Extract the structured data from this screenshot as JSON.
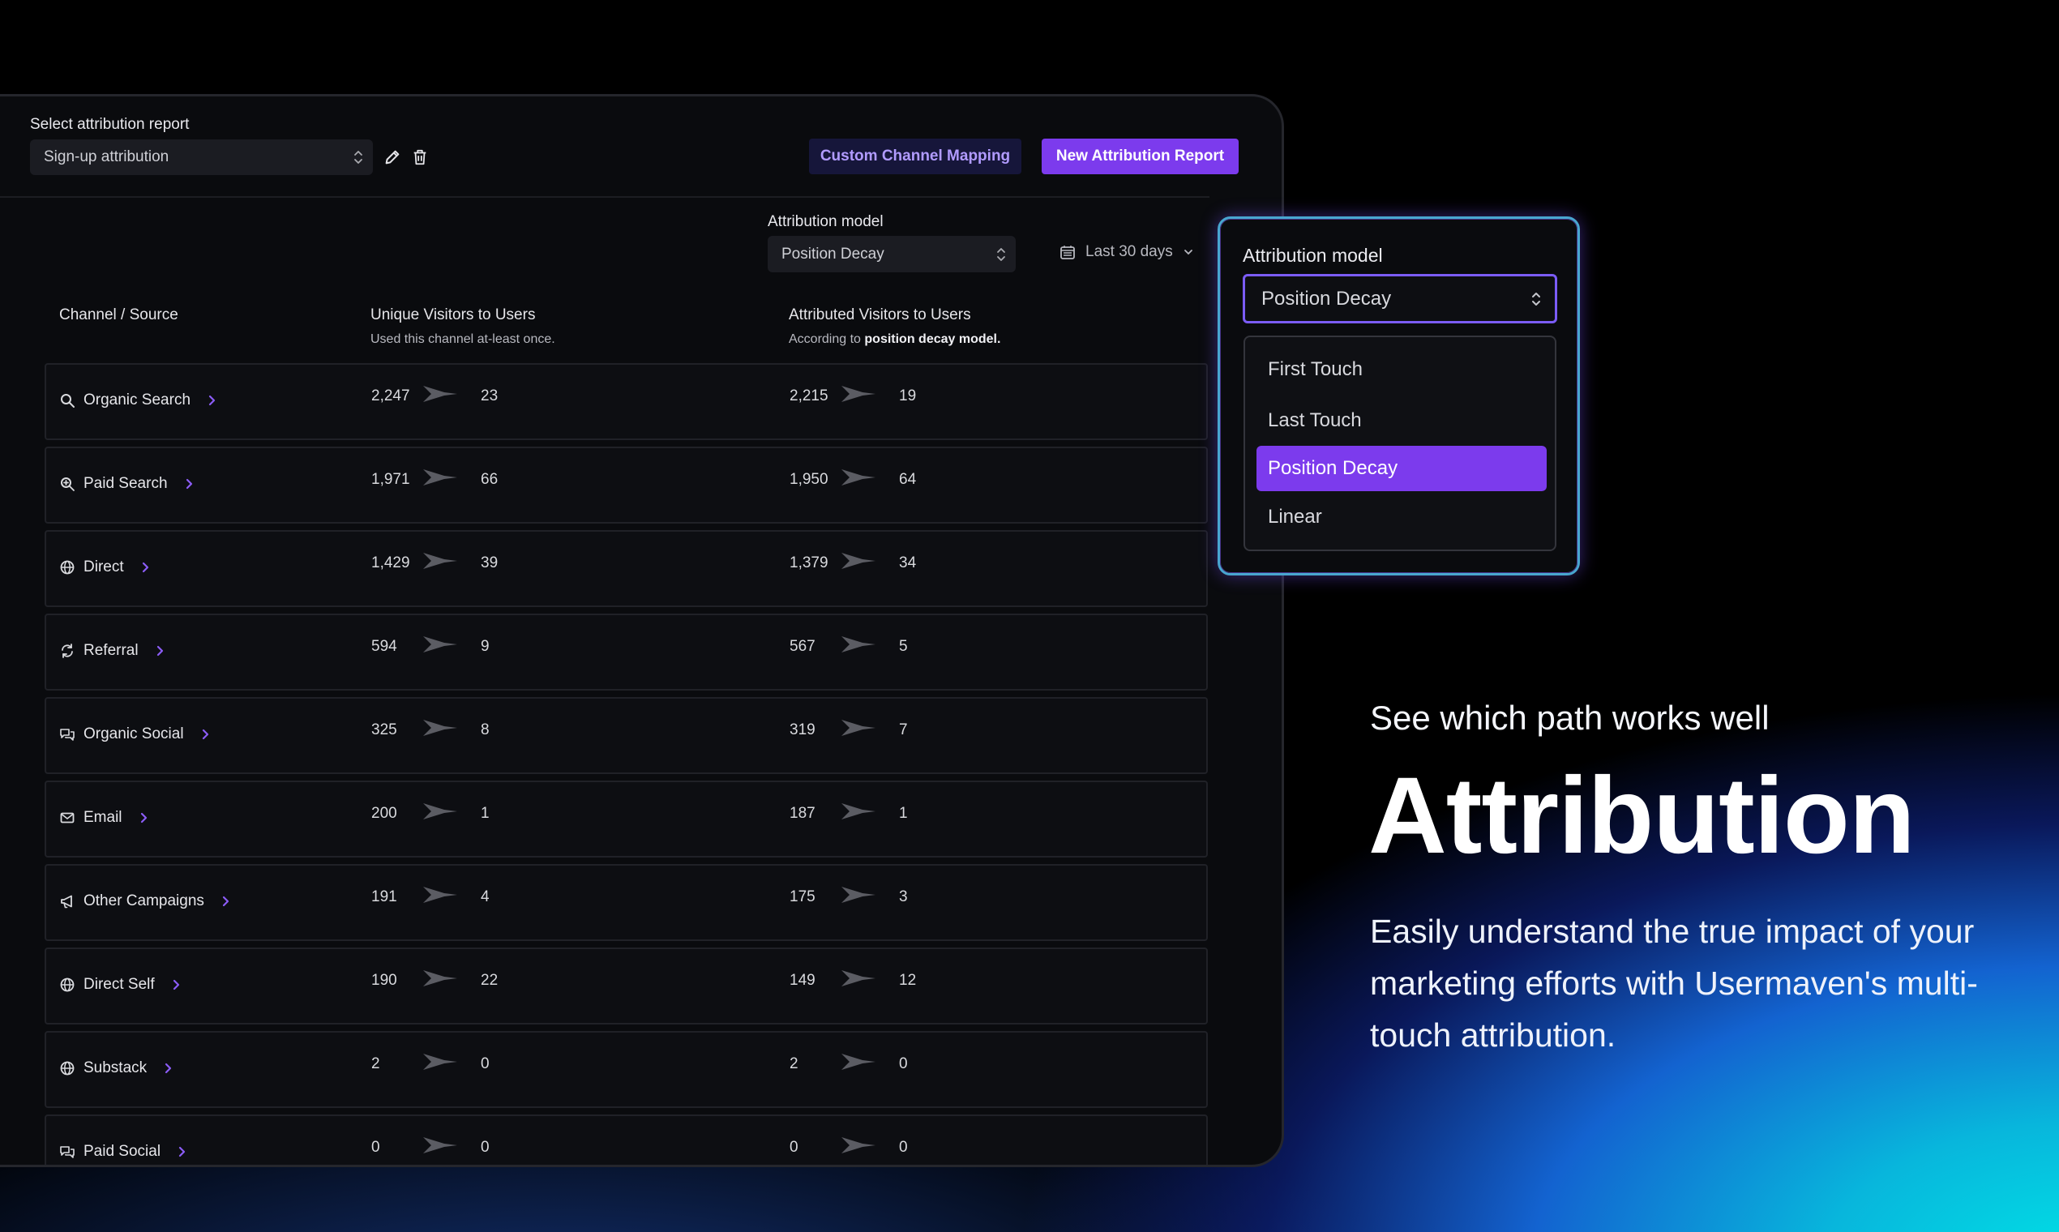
{
  "toolbar": {
    "select_label": "Select attribution report",
    "report_value": "Sign-up attribution",
    "custom_mapping_label": "Custom Channel Mapping",
    "new_report_label": "New Attribution Report"
  },
  "filters": {
    "model_label": "Attribution model",
    "model_value": "Position Decay",
    "date_range": "Last 30 days"
  },
  "table": {
    "headers": {
      "channel": "Channel / Source",
      "unique": "Unique Visitors to Users",
      "unique_sub": "Used this channel at-least once.",
      "attributed": "Attributed Visitors to Users",
      "attributed_sub_prefix": "According to",
      "attributed_sub_bold": "position decay model."
    },
    "rows": [
      {
        "channel": "Organic Search",
        "icon": "search-icon",
        "unique_visitors": "2,247",
        "unique_users": "23",
        "attr_visitors": "2,215",
        "attr_users": "19"
      },
      {
        "channel": "Paid Search",
        "icon": "zoom-in-icon",
        "unique_visitors": "1,971",
        "unique_users": "66",
        "attr_visitors": "1,950",
        "attr_users": "64"
      },
      {
        "channel": "Direct",
        "icon": "globe-icon",
        "unique_visitors": "1,429",
        "unique_users": "39",
        "attr_visitors": "1,379",
        "attr_users": "34"
      },
      {
        "channel": "Referral",
        "icon": "refresh-icon",
        "unique_visitors": "594",
        "unique_users": "9",
        "attr_visitors": "567",
        "attr_users": "5"
      },
      {
        "channel": "Organic Social",
        "icon": "chat-icon",
        "unique_visitors": "325",
        "unique_users": "8",
        "attr_visitors": "319",
        "attr_users": "7"
      },
      {
        "channel": "Email",
        "icon": "mail-icon",
        "unique_visitors": "200",
        "unique_users": "1",
        "attr_visitors": "187",
        "attr_users": "1"
      },
      {
        "channel": "Other Campaigns",
        "icon": "megaphone-icon",
        "unique_visitors": "191",
        "unique_users": "4",
        "attr_visitors": "175",
        "attr_users": "3"
      },
      {
        "channel": "Direct Self",
        "icon": "globe-icon",
        "unique_visitors": "190",
        "unique_users": "22",
        "attr_visitors": "149",
        "attr_users": "12"
      },
      {
        "channel": "Substack",
        "icon": "globe-icon",
        "unique_visitors": "2",
        "unique_users": "0",
        "attr_visitors": "2",
        "attr_users": "0"
      },
      {
        "channel": "Paid Social",
        "icon": "chat-icon",
        "unique_visitors": "0",
        "unique_users": "0",
        "attr_visitors": "0",
        "attr_users": "0"
      }
    ]
  },
  "dropdown": {
    "label": "Attribution model",
    "value": "Position Decay",
    "options": [
      "First Touch",
      "Last Touch",
      "Position Decay",
      "Linear"
    ],
    "selected_index": 2
  },
  "hero": {
    "tagline": "See which path works well",
    "headline": "Attribution",
    "description": "Easily understand the true impact of your marketing efforts with Usermaven's multi-touch attribution."
  },
  "colors": {
    "accent": "#7c3bed",
    "accent_text": "#b19bff",
    "chevron": "#8b5cf6",
    "panel_bg": "#0a0b0e",
    "row_bg": "#0d0e12",
    "glow_border": "#48a6cf"
  }
}
